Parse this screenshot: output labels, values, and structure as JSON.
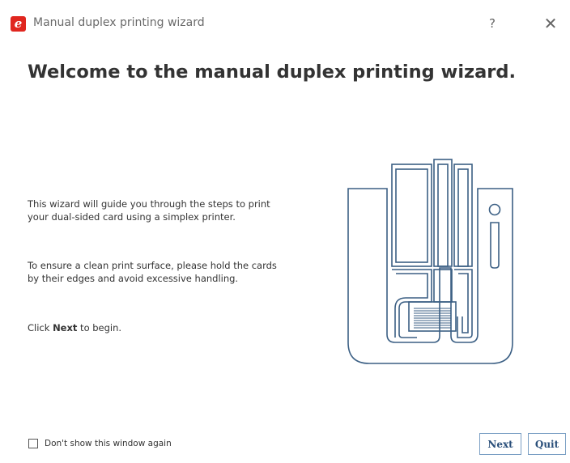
{
  "window": {
    "title": "Manual duplex printing wizard",
    "icon_letter": "e",
    "help_label": "?",
    "close_label": "✕",
    "accent_color": "#e0261f"
  },
  "main": {
    "heading": "Welcome to the manual duplex printing wizard.",
    "paragraph1": "This wizard will guide you through the steps to print your dual-sided card using a simplex printer.",
    "paragraph2": "To ensure a clean print surface, please hold the cards by their edges and avoid excessive handling.",
    "paragraph3_prefix": "Click ",
    "paragraph3_bold": "Next",
    "paragraph3_suffix": " to begin.",
    "illustration_icon": "card-printer-icon",
    "illustration_color": "#3b5f84"
  },
  "footer": {
    "checkbox_label": "Don't show this window again",
    "checkbox_checked": false,
    "next_label": "Next",
    "quit_label": "Quit"
  }
}
